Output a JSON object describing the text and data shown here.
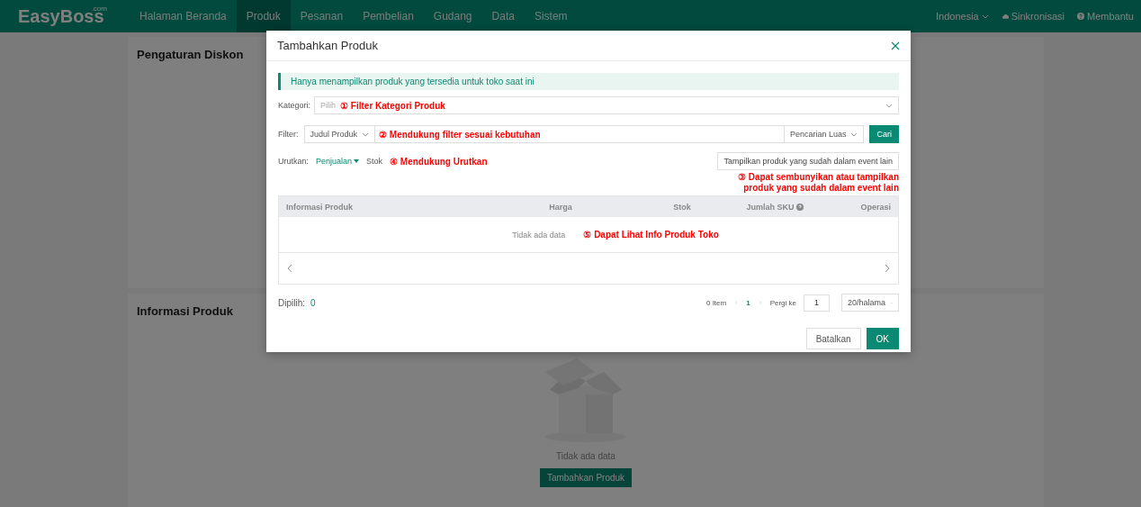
{
  "nav": {
    "logo": "EasyBoss",
    "logo_suffix": ".com",
    "items": [
      {
        "label": "Halaman Beranda",
        "selected": false
      },
      {
        "label": "Produk",
        "selected": true
      },
      {
        "label": "Pesanan",
        "selected": false
      },
      {
        "label": "Pembelian",
        "selected": false
      },
      {
        "label": "Gudang",
        "selected": false
      },
      {
        "label": "Data",
        "selected": false
      },
      {
        "label": "Sistem",
        "selected": false
      }
    ],
    "language": "Indonesia",
    "sync": "Sinkronisasi",
    "help": "Membantu"
  },
  "page": {
    "discount_card": {
      "title": "Pengaturan Diskon"
    },
    "product_card": {
      "title": "Informasi Produk",
      "empty_text": "Tidak ada data",
      "button": "Tambahkan Produk"
    }
  },
  "dialog": {
    "title": "Tambahkan Produk",
    "notice": "Hanya menampilkan produk yang tersedia untuk toko saat ini",
    "category": {
      "label": "Kategori:",
      "placeholder": "Pilih"
    },
    "filter": {
      "label": "Filter:",
      "field": "Judul Produk",
      "mode": "Pencarian Luas",
      "button": "Cari"
    },
    "sort": {
      "label": "Urutkan:",
      "options": [
        {
          "label": "Penjualan",
          "selected": true
        },
        {
          "label": "Stok",
          "selected": false
        }
      ]
    },
    "toggle_button": "Tampilkan produk yang sudah dalam event lain",
    "table": {
      "columns": [
        "Informasi Produk",
        "Harga",
        "Stok",
        "Jumlah SKU",
        "Operasi"
      ],
      "empty_text": "Tidak ada data"
    },
    "selected_label": "Dipilih:",
    "selected_count": "0",
    "pagination": {
      "total": "0 Item",
      "pages": [
        {
          "label": "1",
          "selected": true
        }
      ],
      "goto_label": "Pergi ke",
      "goto_value": "1",
      "page_size": "20/halama"
    },
    "buttons": [
      {
        "label": "Batalkan",
        "kind": "secondary"
      },
      {
        "label": "OK",
        "kind": "primary"
      }
    ]
  },
  "annotations": [
    {
      "number": "①",
      "text": "Filter Kategori Produk"
    },
    {
      "number": "②",
      "text": "Mendukung filter sesuai kebutuhan"
    },
    {
      "number": "③",
      "text": "Dapat sembunyikan atau tampilkan produk yang sudah dalam event lain"
    },
    {
      "number": "④",
      "text": "Mendukung Urutkan"
    },
    {
      "number": "⑤",
      "text": "Dapat Lihat Info Produk Toko"
    }
  ]
}
